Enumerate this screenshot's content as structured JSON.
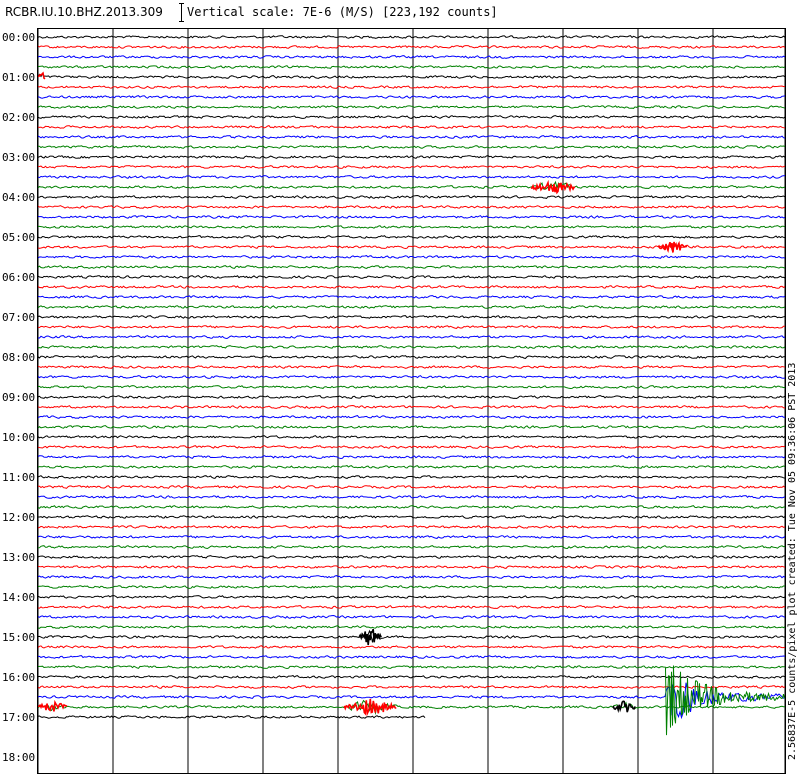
{
  "header": {
    "station": "RCBR.IU.10.BHZ.2013.309",
    "scale_label": "Vertical scale: 7E-6 (M/S) [223,192 counts]"
  },
  "side_label": "2.56837E-5 counts/pixel plot created: Tue Nov 05 09:36:06 PST 2013",
  "chart_data": {
    "type": "line",
    "title": "RCBR.IU.10.BHZ.2013.309",
    "hour_labels": [
      "00:00",
      "01:00",
      "02:00",
      "03:00",
      "04:00",
      "05:00",
      "06:00",
      "07:00",
      "08:00",
      "09:00",
      "10:00",
      "11:00",
      "12:00",
      "13:00",
      "14:00",
      "15:00",
      "16:00",
      "17:00",
      "18:00"
    ],
    "traces_per_hour": 4,
    "trace_colors": [
      "#000000",
      "#ff0000",
      "#0000ff",
      "#008000"
    ],
    "total_traces": 69,
    "last_trace_end_fraction": 0.52,
    "vertical_scale": "7E-6 (M/S)",
    "vertical_scale_counts": 223192,
    "events": [
      {
        "trace": 15,
        "start": 0.66,
        "end": 0.72,
        "amplitude": 5,
        "color": "#ff0000"
      },
      {
        "trace": 21,
        "start": 0.83,
        "end": 0.87,
        "amplitude": 5,
        "color": "#ff0000"
      },
      {
        "trace": 4,
        "start": 0.0,
        "end": 0.01,
        "amplitude": 5,
        "color": "#ff0000"
      },
      {
        "trace": 60,
        "start": 0.43,
        "end": 0.46,
        "amplitude": 9,
        "color": "#000000"
      },
      {
        "trace": 67,
        "start": 0.0,
        "end": 0.04,
        "amplitude": 4,
        "color": "#ff0000"
      },
      {
        "trace": 67,
        "start": 0.41,
        "end": 0.48,
        "amplitude": 7,
        "color": "#ff0000"
      },
      {
        "trace": 67,
        "start": 0.77,
        "end": 0.8,
        "amplitude": 5,
        "color": "#000000"
      },
      {
        "trace": 66,
        "start": 0.84,
        "end": 1.0,
        "amplitude": 40,
        "color": "#008000",
        "type": "quake"
      }
    ],
    "grid": true
  }
}
